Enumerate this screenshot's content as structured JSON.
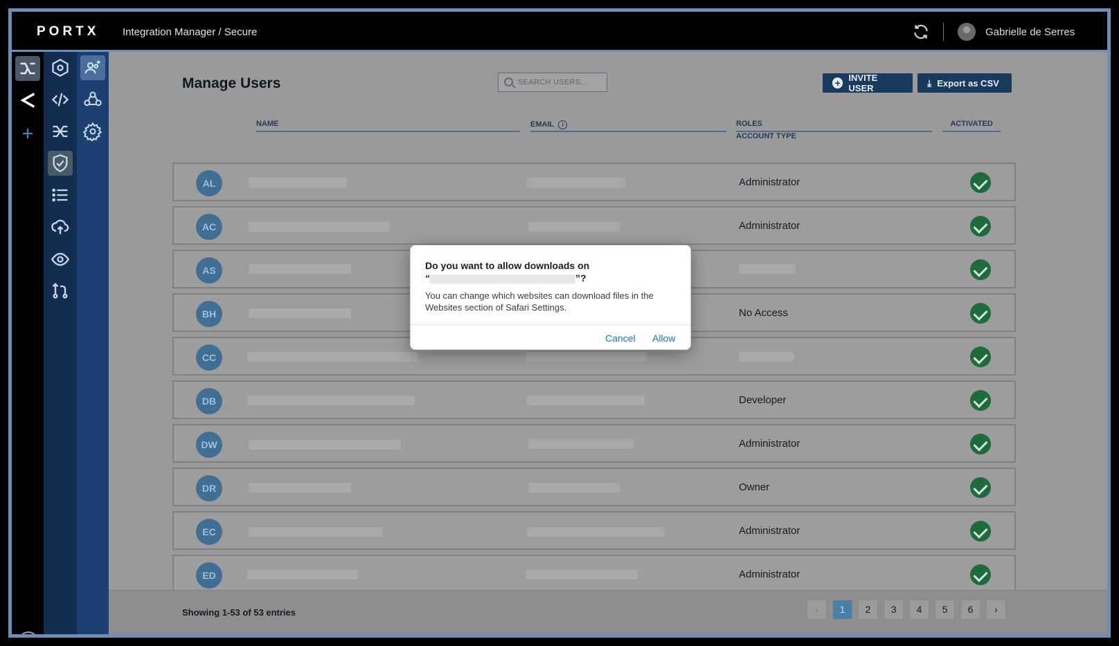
{
  "app": {
    "logo": "PORTX",
    "breadcrumb": "Integration Manager / Secure",
    "user_name": "Gabrielle de Serres"
  },
  "page": {
    "title": "Manage Users",
    "search_placeholder": "SEARCH USERS...",
    "invite_label": "INVITE USER",
    "export_label": "Export as CSV"
  },
  "table": {
    "headers": {
      "name": "NAME",
      "email": "EMAIL",
      "roles": "ROLES",
      "account_type": "ACCOUNT TYPE",
      "activated": "ACTIVATED"
    },
    "rows": [
      {
        "initials": "AL",
        "role": "Administrator",
        "activated": true
      },
      {
        "initials": "AC",
        "role": "Administrator",
        "activated": true
      },
      {
        "initials": "AS",
        "role": "",
        "activated": true
      },
      {
        "initials": "BH",
        "role": "No Access",
        "activated": true
      },
      {
        "initials": "CC",
        "role": "",
        "activated": true
      },
      {
        "initials": "DB",
        "role": "Developer",
        "activated": true
      },
      {
        "initials": "DW",
        "role": "Administrator",
        "activated": true
      },
      {
        "initials": "DR",
        "role": "Owner",
        "activated": true
      },
      {
        "initials": "EC",
        "role": "Administrator",
        "activated": true
      },
      {
        "initials": "ED",
        "role": "Administrator",
        "activated": true
      }
    ]
  },
  "footer": {
    "showing": "Showing 1-53 of 53 entries",
    "pages": [
      "1",
      "2",
      "3",
      "4",
      "5",
      "6"
    ],
    "prev": "‹",
    "next": "›"
  },
  "dialog": {
    "title_prefix": "Do you want to allow downloads on",
    "title_open_quote": "“",
    "title_close": "”?",
    "body": "You can change which websites can download files in the Websites section of Safari Settings.",
    "cancel": "Cancel",
    "allow": "Allow"
  },
  "colors": {
    "accent": "#1a3a5e",
    "activated": "#1e6b3b",
    "dialog_link": "#1a6fd8"
  }
}
